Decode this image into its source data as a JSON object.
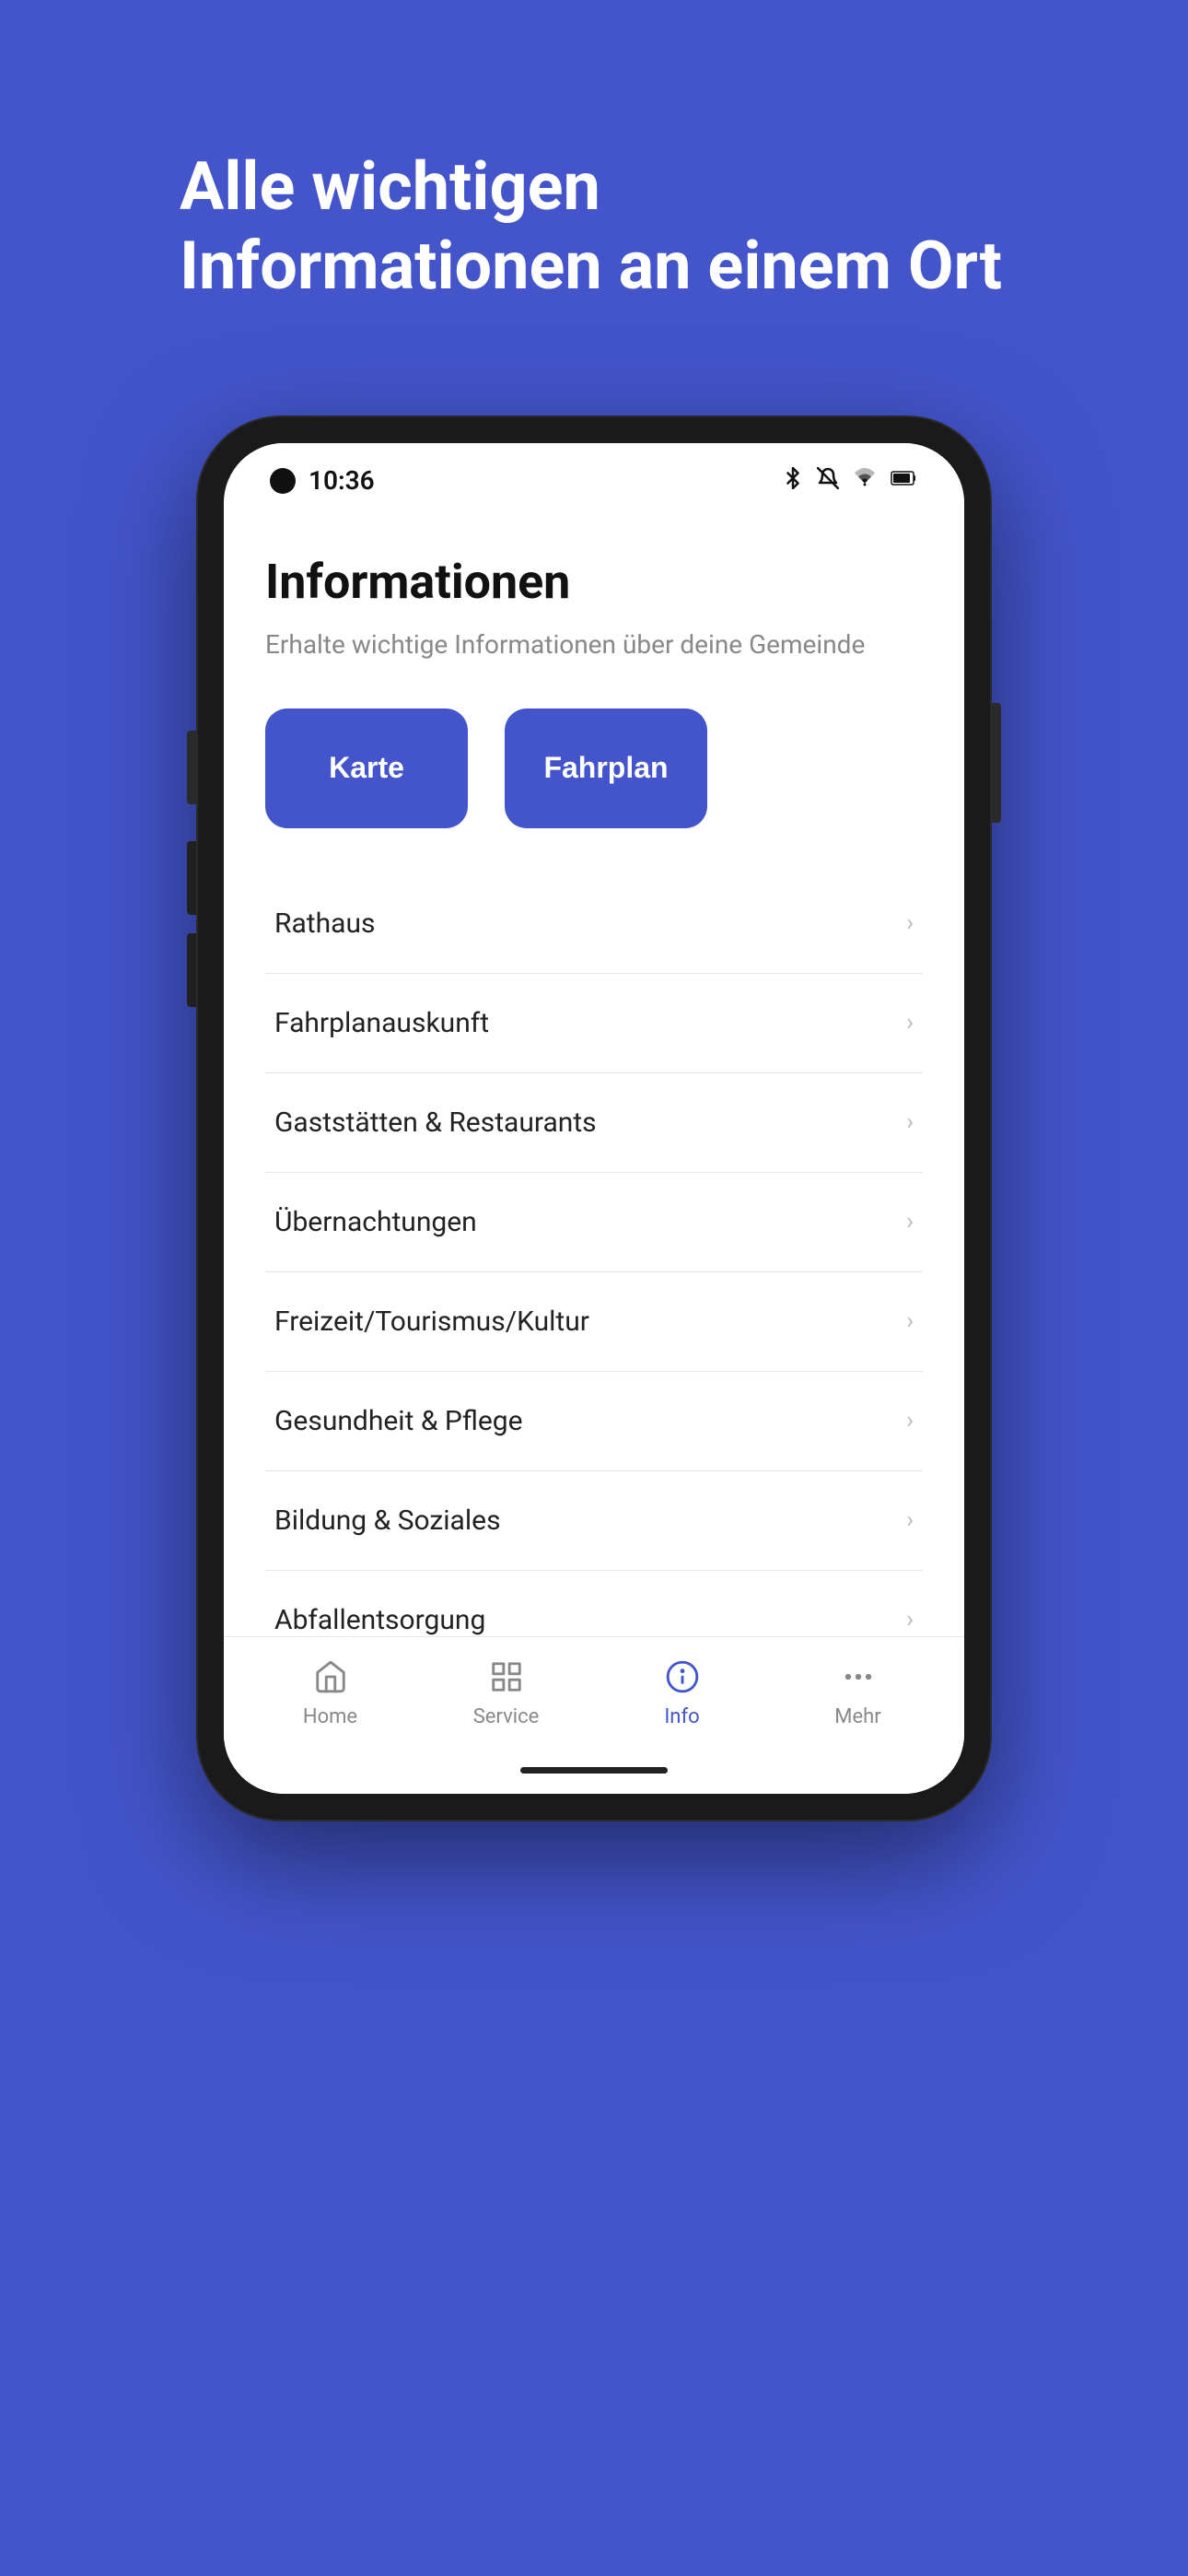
{
  "background": {
    "color": "#4455cc"
  },
  "headline": {
    "text": "Alle wichtigen Informationen an einem Ort"
  },
  "phone": {
    "statusBar": {
      "time": "10:36",
      "icons": [
        "bluetooth",
        "bell-off",
        "wifi",
        "battery"
      ]
    },
    "app": {
      "title": "Informationen",
      "subtitle": "Erhalte wichtige Informationen über deine Gemeinde",
      "buttons": [
        {
          "label": "Karte"
        },
        {
          "label": "Fahrplan"
        }
      ],
      "listItems": [
        {
          "label": "Rathaus"
        },
        {
          "label": "Fahrplanauskunft"
        },
        {
          "label": "Gaststätten & Restaurants"
        },
        {
          "label": "Übernachtungen"
        },
        {
          "label": "Freizeit/Tourismus/Kultur"
        },
        {
          "label": "Gesundheit & Pflege"
        },
        {
          "label": "Bildung & Soziales"
        },
        {
          "label": "Abfallentsorgung"
        }
      ],
      "bottomNav": [
        {
          "id": "home",
          "label": "Home",
          "active": false
        },
        {
          "id": "service",
          "label": "Service",
          "active": false
        },
        {
          "id": "info",
          "label": "Info",
          "active": true
        },
        {
          "id": "mehr",
          "label": "Mehr",
          "active": false
        }
      ]
    }
  }
}
